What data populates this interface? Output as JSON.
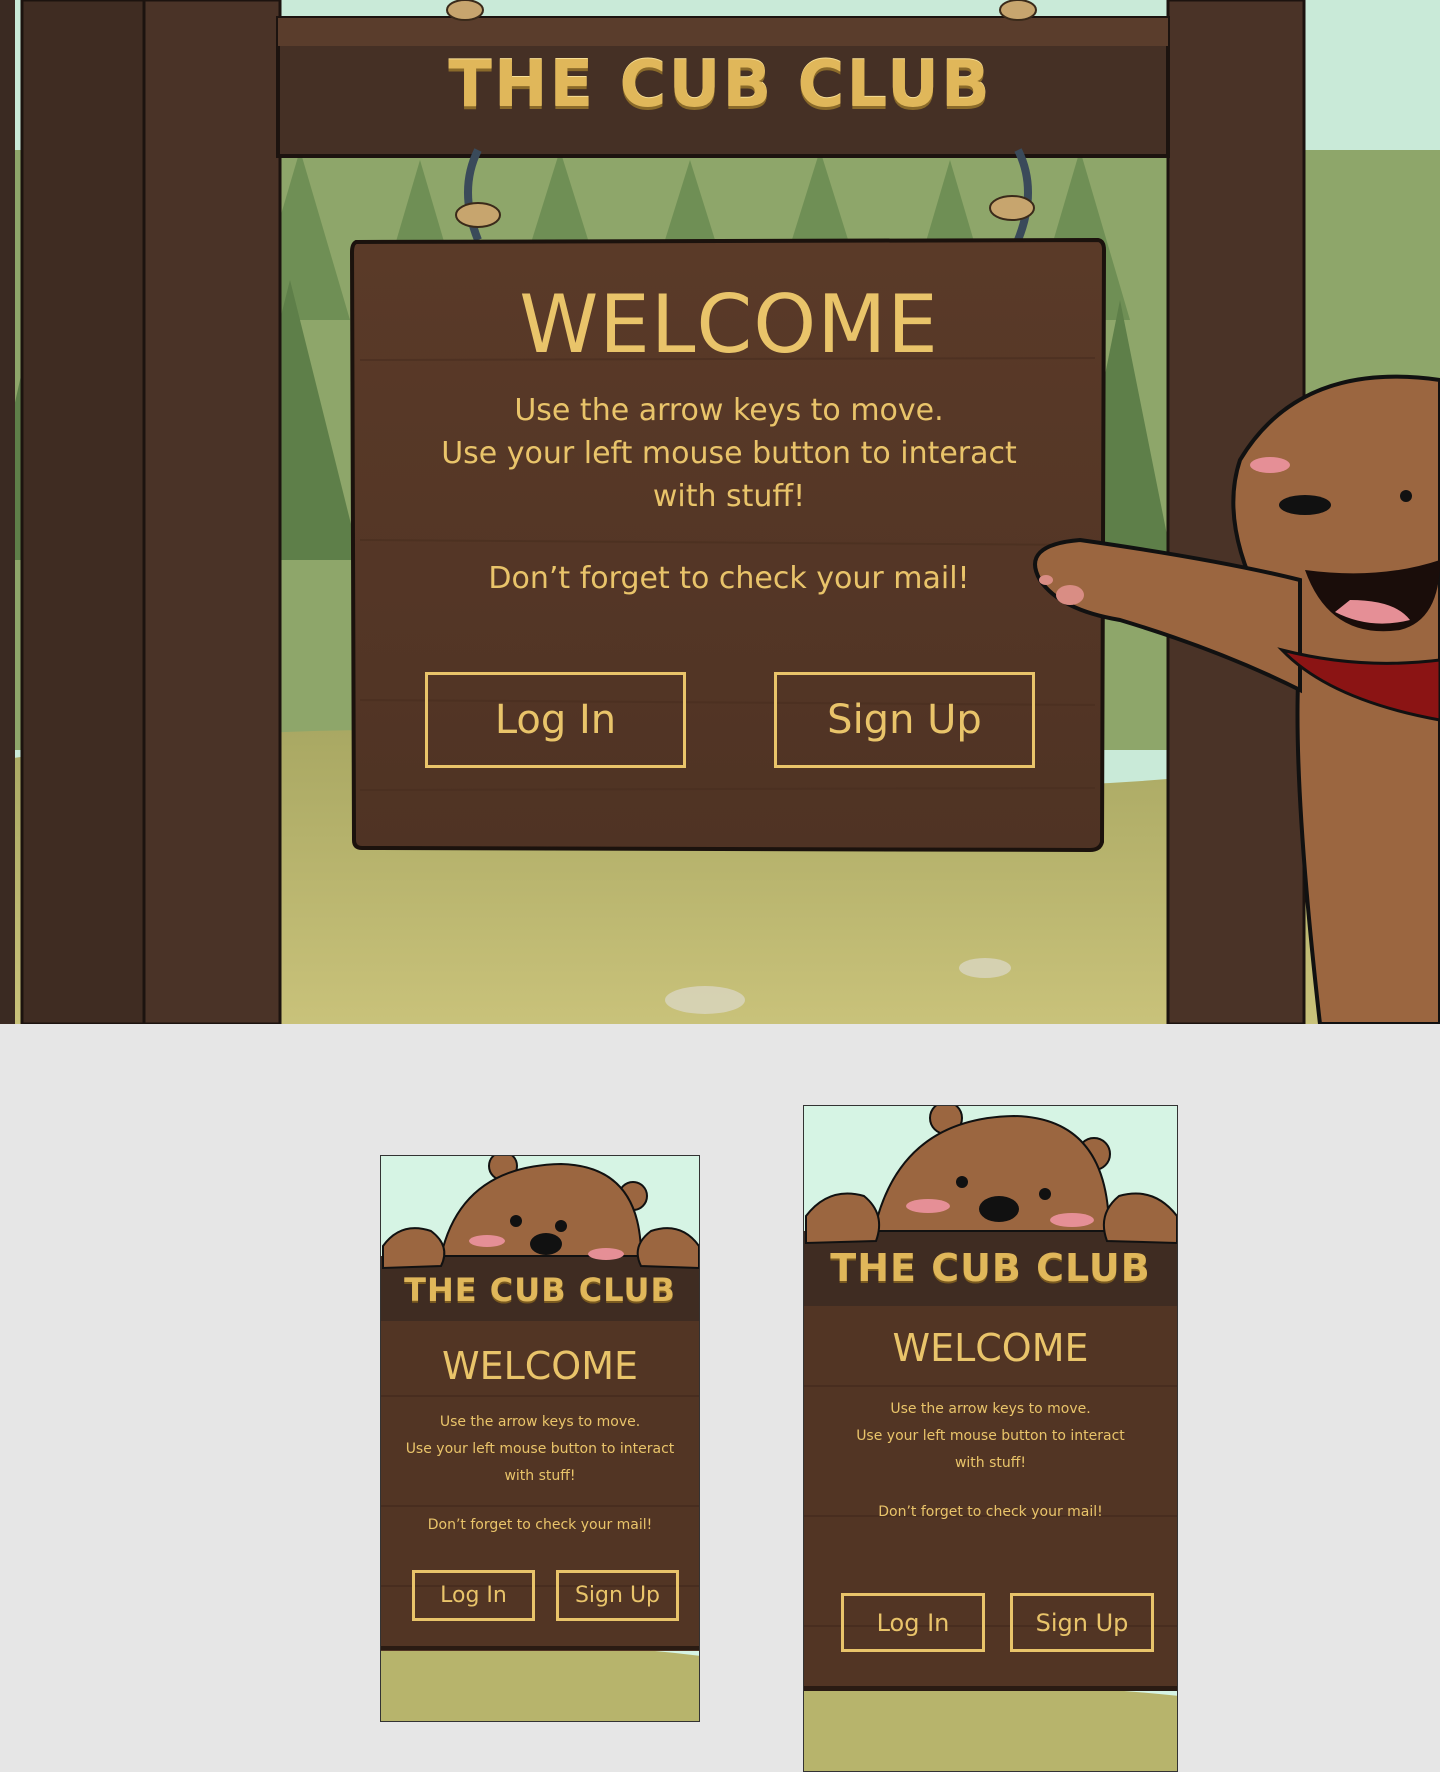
{
  "desktop": {
    "title": "THE CUB CLUB",
    "welcome": "WELCOME",
    "instructions": [
      "Use the arrow keys to move.",
      "Use your left mouse  button to interact",
      "with stuff!"
    ],
    "mail": "Don’t forget to check  your mail!",
    "login_label": "Log In",
    "signup_label": "Sign Up"
  },
  "mobile_small": {
    "title": "THE CUB CLUB",
    "welcome": "WELCOME",
    "instructions": [
      "Use the arrow keys to move.",
      "Use your left mouse  button to interact",
      "with stuff!"
    ],
    "mail": "Don’t forget to check  your mail!",
    "login_label": "Log In",
    "signup_label": "Sign Up"
  },
  "mobile_large": {
    "title": "THE CUB CLUB",
    "welcome": "WELCOME",
    "instructions": [
      "Use the arrow keys to move.",
      "Use your left mouse  button to interact",
      "with stuff!"
    ],
    "mail": "Don’t forget to check  your mail!",
    "login_label": "Log In",
    "signup_label": "Sign Up"
  },
  "colors": {
    "accent": "#e9c46a",
    "wood_dark": "#3f2c22",
    "wood_sign": "#563826",
    "sky": "#d4f3e3"
  }
}
